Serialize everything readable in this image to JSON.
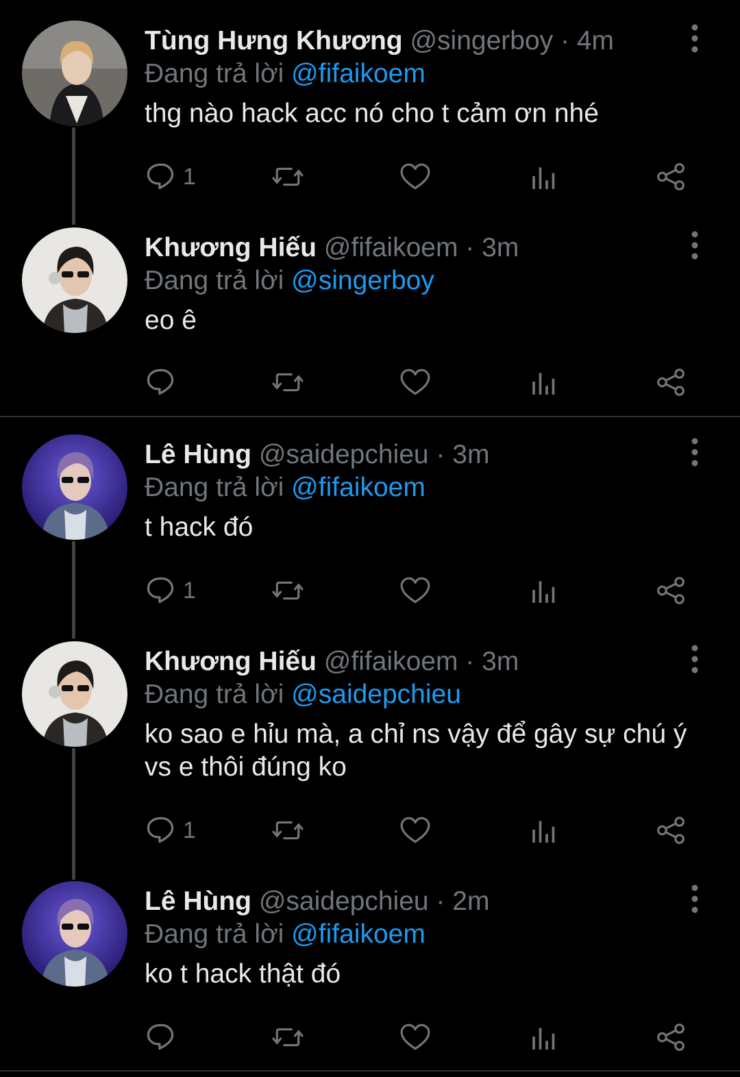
{
  "reply_prefix": "Đang trả lời",
  "tweets": [
    {
      "name": "Tùng Hưng Khương",
      "handle": "@singerboy",
      "dot": "·",
      "time": "4m",
      "replying_to": "@fifaikoem",
      "text": "thg nào hack acc nó cho t cảm ơn nhé",
      "reply_count": "1"
    },
    {
      "name": "Khương Hiếu",
      "handle": "@fifaikoem",
      "dot": "·",
      "time": "3m",
      "replying_to": "@singerboy",
      "text": "eo ê",
      "reply_count": ""
    },
    {
      "name": "Lê Hùng",
      "handle": "@saidepchieu",
      "dot": "·",
      "time": "3m",
      "replying_to": "@fifaikoem",
      "text": "t hack đó",
      "reply_count": "1"
    },
    {
      "name": "Khương Hiếu",
      "handle": "@fifaikoem",
      "dot": "·",
      "time": "3m",
      "replying_to": "@saidepchieu",
      "text": "ko sao e hỉu mà, a chỉ ns vậy để gây sự chú ý vs e thôi đúng ko",
      "reply_count": "1"
    },
    {
      "name": "Lê Hùng",
      "handle": "@saidepchieu",
      "dot": "·",
      "time": "2m",
      "replying_to": "@fifaikoem",
      "text": "ko t hack thật đó",
      "reply_count": ""
    }
  ],
  "colors": {
    "background": "#000000",
    "text": "#e7e9ea",
    "muted": "#71767b",
    "mention": "#1d9bf0",
    "thread_line": "#3e4144"
  },
  "icons": [
    "reply-icon",
    "retweet-icon",
    "like-icon",
    "views-icon",
    "share-icon",
    "more-icon"
  ]
}
